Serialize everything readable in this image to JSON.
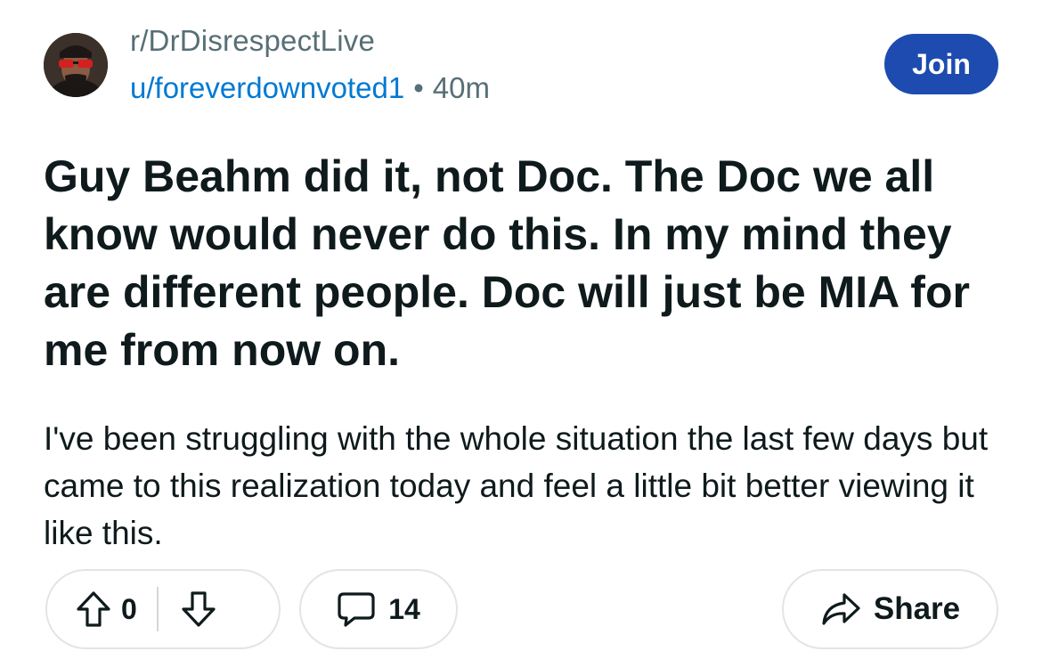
{
  "header": {
    "subreddit": "r/DrDisrespectLive",
    "author": "u/foreverdownvoted1",
    "separator": "•",
    "age": "40m",
    "join_label": "Join"
  },
  "post": {
    "title": "Guy Beahm did it, not Doc. The Doc we all know would never do this. In my mind they are different people. Doc will just be MIA for me from now on.",
    "body": "I've been struggling with the whole situation the last few days but came to this realization today and feel a little bit better viewing it like this."
  },
  "actions": {
    "score": "0",
    "comment_count": "14",
    "share_label": "Share"
  },
  "icons": {
    "upvote": "arrow-up-icon",
    "downvote": "arrow-down-icon",
    "comments": "speech-bubble-icon",
    "share": "share-arrow-icon"
  },
  "colors": {
    "join_button": "#1d4bb0",
    "author_link": "#0079d3",
    "muted_text": "#576f76",
    "pill_border": "#e2e4e6"
  }
}
